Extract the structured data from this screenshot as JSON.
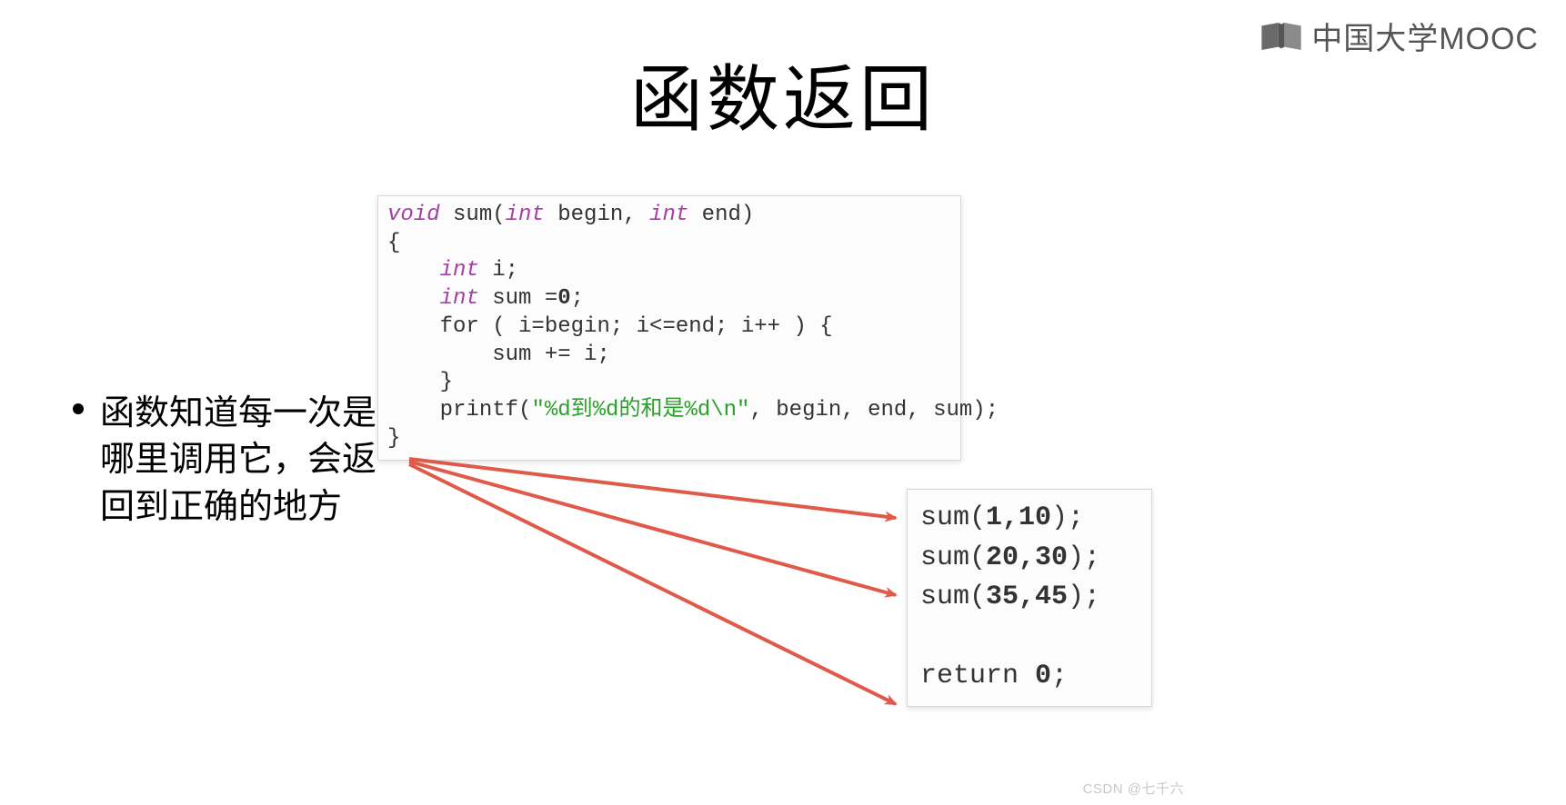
{
  "logo": {
    "text": "中国大学MOOC"
  },
  "title": "函数返回",
  "bullet": "函数知道每一次是哪里调用它，会返回到正确的地方",
  "code_top": {
    "l1a": "void",
    "l1b": " sum(",
    "l1c": "int",
    "l1d": " begin, ",
    "l1e": "int",
    "l1f": " end)",
    "l2": "{",
    "l3a": "    ",
    "l3b": "int",
    "l3c": " i;",
    "l4a": "    ",
    "l4b": "int",
    "l4c": " sum =",
    "l4d": "0",
    "l4e": ";",
    "l5": "    for ( i=begin; i<=end; i++ ) {",
    "l6": "        sum += i;",
    "l7": "    }",
    "l8a": "    printf(",
    "l8b": "\"%d到%d的和是%d\\n\"",
    "l8c": ", begin, end, sum);",
    "l9": "}"
  },
  "code_bottom": {
    "l1a": "sum(",
    "l1b": "1,10",
    "l1c": ");",
    "l2a": "sum(",
    "l2b": "20,30",
    "l2c": ");",
    "l3a": "sum(",
    "l3b": "35,45",
    "l3c": ");",
    "l4": "",
    "l5a": "return ",
    "l5b": "0",
    "l5c": ";"
  },
  "watermark": "CSDN @七千六",
  "colors": {
    "arrow": "#e05a4a",
    "keyword": "#a63fa6",
    "string": "#2aa12a"
  }
}
